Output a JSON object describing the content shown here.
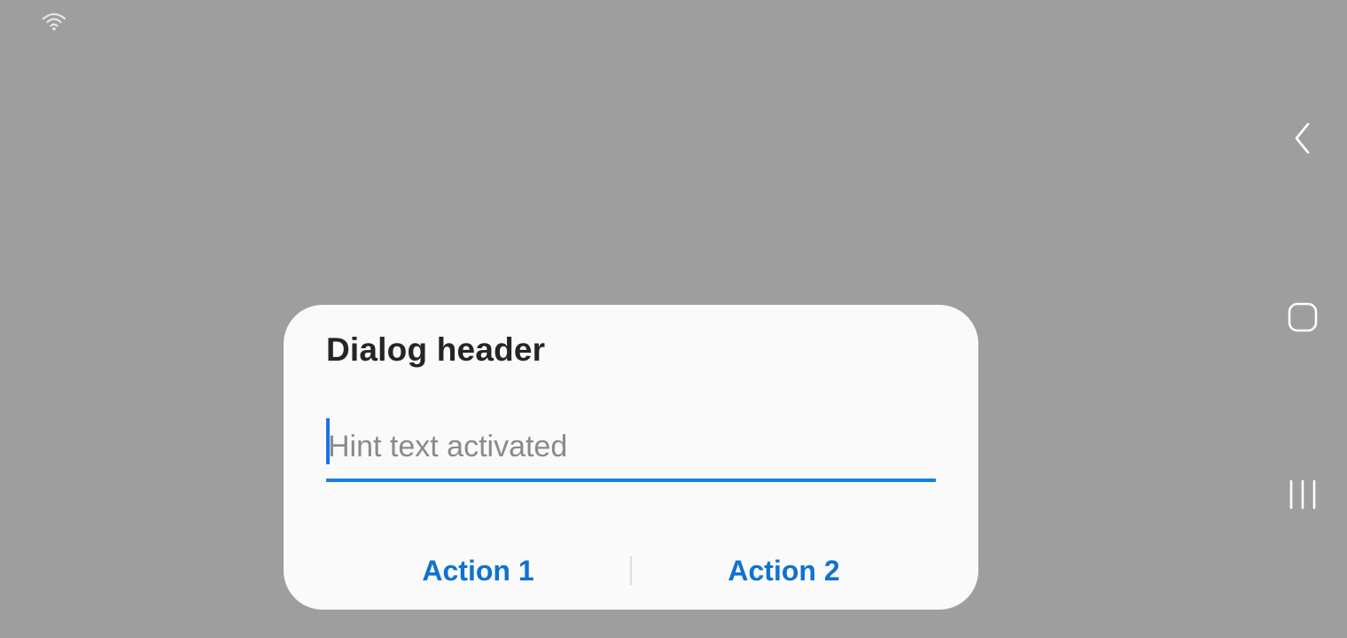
{
  "status_bar": {
    "wifi_icon": "wifi-icon"
  },
  "nav_bar": {
    "back_icon": "back-chevron-icon",
    "home_icon": "home-icon",
    "recents_icon": "recents-icon"
  },
  "dialog": {
    "header": "Dialog header",
    "input": {
      "value": "",
      "placeholder": "Hint text activated"
    },
    "actions": [
      {
        "label": "Action 1"
      },
      {
        "label": "Action 2"
      }
    ]
  },
  "colors": {
    "scrim": "#9e9e9e",
    "dialog_bg": "#fafafa",
    "accent": "#1a7fe4",
    "action_text": "#0f72d1",
    "header_text": "#252525",
    "hint_text": "#8a8a8a"
  }
}
